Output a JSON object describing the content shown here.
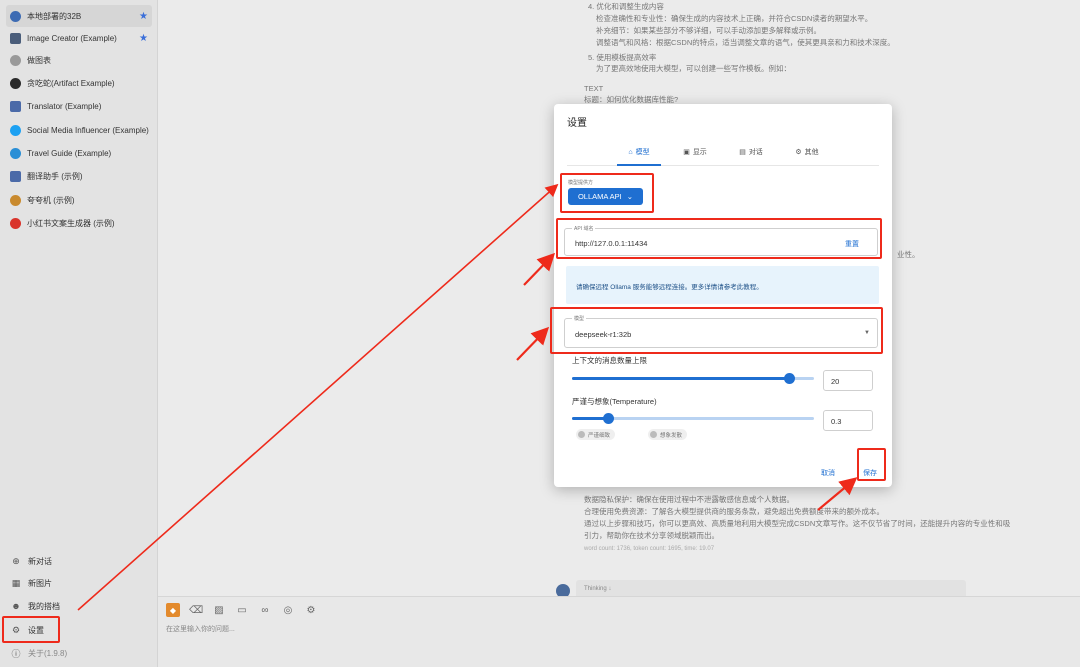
{
  "sidebar": {
    "items": [
      {
        "label": "本地部署的32B",
        "icon_color": "#3d6bb3",
        "starred": true
      },
      {
        "label": "Image Creator (Example)",
        "icon_color": "#4a5d7a",
        "starred": true
      },
      {
        "label": "做图表",
        "icon_color": "#7a7a7a",
        "starred": false
      },
      {
        "label": "贪吃蛇(Artifact Example)",
        "icon_color": "#2b2b2b",
        "starred": false
      },
      {
        "label": "Translator (Example)",
        "icon_color": "#4b6aa8",
        "starred": false
      },
      {
        "label": "Social Media Influencer (Example)",
        "icon_color": "#1da1f2",
        "starred": false
      },
      {
        "label": "Travel Guide (Example)",
        "icon_color": "#2a8fd6",
        "starred": false
      },
      {
        "label": "翻译助手 (示例)",
        "icon_color": "#4b6aa8",
        "starred": false
      },
      {
        "label": "夸夸机 (示例)",
        "icon_color": "#c98a2e",
        "starred": false
      },
      {
        "label": "小红书文案生成器 (示例)",
        "icon_color": "#d9342b",
        "starred": false
      }
    ],
    "bottom": [
      {
        "label": "新对话",
        "icon": "plus-circle-icon",
        "glyph": "⊕"
      },
      {
        "label": "新图片",
        "icon": "image-icon",
        "glyph": "▦"
      },
      {
        "label": "我的搭档",
        "icon": "partner-icon",
        "glyph": "☻"
      },
      {
        "label": "设置",
        "icon": "gear-icon",
        "glyph": "⚙"
      },
      {
        "label": "关于(1.9.8)",
        "icon": "info-icon",
        "glyph": "ⓘ"
      }
    ]
  },
  "background": {
    "lines": [
      "4. 优化和调整生成内容",
      "检查准确性和专业性：确保生成的内容技术上正确，并符合CSDN读者的期望水平。",
      "补充细节：如果某些部分不够详细，可以手动添加更多解释或示例。",
      "调整语气和风格：根据CSDN的特点，适当调整文章的语气，使其更具亲和力和技术深度。",
      "5. 使用模板提高效率",
      "为了更高效地使用大模型，可以创建一些写作模板。例如：",
      "TEXT",
      "标题：如何优化数据库性能?",
      "业性。",
      "数据隐私保护：确保在使用过程中不泄露敏感信息或个人数据。",
      "合理使用免费资源：了解各大模型提供商的服务条款，避免超出免费额度带来的额外成本。",
      "通过以上步骤和技巧，你可以更高效、高质量地利用大模型完成CSDN文章写作。这不仅节省了时间，还能提升内容的专业性和吸",
      "引力，帮助你在技术分享领域脱颖而出。",
      "word count: 1736, token count: 1695, time: 19.07",
      "Thinking"
    ]
  },
  "input": {
    "placeholder": "在这里输入你的问题..."
  },
  "settings": {
    "title": "设置",
    "tabs": [
      {
        "label": "模型",
        "icon": "model-icon",
        "glyph": "⌂"
      },
      {
        "label": "显示",
        "icon": "display-icon",
        "glyph": "▣"
      },
      {
        "label": "对话",
        "icon": "chat-icon",
        "glyph": "▤"
      },
      {
        "label": "其他",
        "icon": "gear-icon",
        "glyph": "⚙"
      }
    ],
    "provider_label": "模型提供方",
    "provider_value": "OLLAMA API",
    "api_host_label": "API 域名",
    "api_host_value": "http://127.0.0.1:11434",
    "reset_label": "重置",
    "info_text": "请确保远程 Ollama 服务能够远程连接。更多详情请参考此教程。",
    "model_label": "模型",
    "model_value": "deepseek-r1:32b",
    "context_label": "上下文的消息数量上限",
    "context_value": "20",
    "context_fraction": 0.9,
    "temperature_label": "严谨与想象(Temperature)",
    "temperature_value": "0.3",
    "temperature_fraction": 0.15,
    "chip_strict": "严谨细致",
    "chip_imaginative": "想象发散",
    "cancel_label": "取消",
    "save_label": "保存"
  },
  "colors": {
    "accent": "#1f6fd1",
    "annotation": "#ee2a1b",
    "info_bg": "#e7f3fc"
  }
}
